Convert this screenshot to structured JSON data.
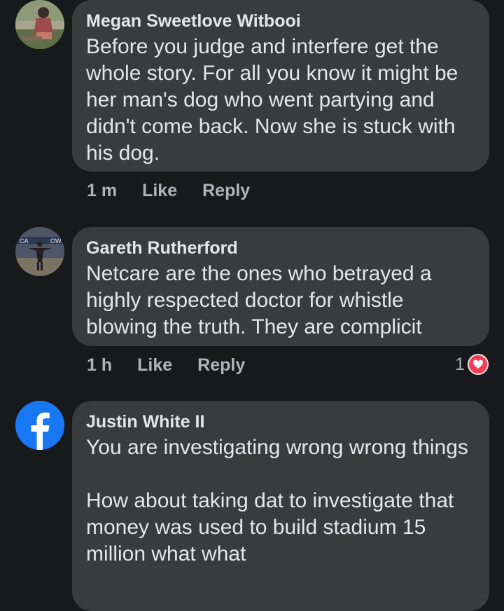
{
  "comments": [
    {
      "author": "Megan Sweetlove Witbooi",
      "text": "Before you judge and interfere get the whole story. For all you know it might be her man's dog who went partying and didn't come back. Now she is stuck with his dog.",
      "time": "1 m",
      "like_label": "Like",
      "reply_label": "Reply",
      "avatar": "user-photo-avatar"
    },
    {
      "author": "Gareth Rutherford",
      "text": "Netcare are the ones who betrayed a highly respected doctor for whistle blowing the truth. They are complicit",
      "time": "1 h",
      "like_label": "Like",
      "reply_label": "Reply",
      "reaction_count": "1",
      "reaction_icon": "heart-reaction-icon",
      "avatar": "user-photo-avatar"
    },
    {
      "author": "Justin White II",
      "text": "You are investigating wrong wrong things\n\nHow about taking dat to investigate that money was used to build stadium 15 million what what",
      "avatar": "facebook-logo-avatar"
    }
  ],
  "colors": {
    "background": "#18191a",
    "bubble": "#3a3b3c",
    "text": "#e4e6eb",
    "secondary": "#b0b3b8",
    "facebook_blue": "#1877f2",
    "heart": "#f33e58"
  }
}
